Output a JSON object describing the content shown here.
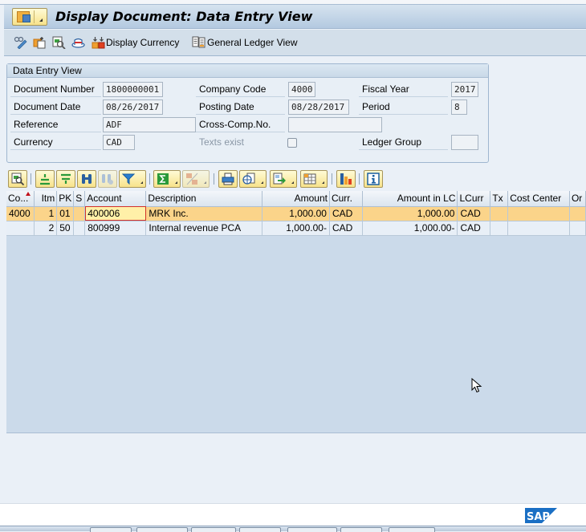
{
  "window": {
    "title": "Display Document: Data Entry View"
  },
  "application_toolbar": {
    "items": [
      {
        "name": "display-change-icon",
        "label": ""
      },
      {
        "name": "other-document-icon",
        "label": ""
      },
      {
        "name": "document-overview-icon",
        "label": ""
      },
      {
        "name": "hat-icon",
        "label": ""
      },
      {
        "name": "display-currency-button",
        "label": "Display Currency"
      },
      {
        "name": "general-ledger-view-button",
        "label": "General Ledger View"
      }
    ]
  },
  "header": {
    "group_title": "Data Entry View",
    "fields": {
      "document_number": {
        "label": "Document Number",
        "value": "1800000001"
      },
      "company_code": {
        "label": "Company Code",
        "value": "4000"
      },
      "fiscal_year": {
        "label": "Fiscal Year",
        "value": "2017"
      },
      "document_date": {
        "label": "Document Date",
        "value": "08/26/2017"
      },
      "posting_date": {
        "label": "Posting Date",
        "value": "08/28/2017"
      },
      "period": {
        "label": "Period",
        "value": "8"
      },
      "reference": {
        "label": "Reference",
        "value": "ADF"
      },
      "cross_comp_no": {
        "label": "Cross-Comp.No.",
        "value": ""
      },
      "currency": {
        "label": "Currency",
        "value": "CAD"
      },
      "texts_exist": {
        "label": "Texts exist",
        "checked": false
      },
      "ledger_group": {
        "label": "Ledger Group",
        "value": ""
      }
    }
  },
  "alv_toolbar": {
    "buttons": [
      "details-icon",
      "sort-ascending-icon",
      "sort-descending-icon",
      "find-icon",
      "find-next-icon",
      "filter-icon",
      "sum-icon",
      "subtotal-icon",
      "print-icon",
      "views-icon",
      "export-icon",
      "layout-icon",
      "graphic-icon",
      "info-icon"
    ]
  },
  "grid": {
    "columns": [
      "Co...",
      "Itm",
      "PK",
      "S",
      "Account",
      "Description",
      "Amount",
      "Curr.",
      "Amount in LC",
      "LCurr",
      "Tx",
      "Cost Center",
      "Or"
    ],
    "rows": [
      {
        "co": "4000",
        "itm": "1",
        "pk": "01",
        "s": "",
        "account": "400006",
        "description": "MRK Inc.",
        "amount": "1,000.00",
        "curr": "CAD",
        "amount_lc": "1,000.00",
        "lcurr": "CAD",
        "tx": "",
        "cost_center": "",
        "or": "",
        "selected": true
      },
      {
        "co": "",
        "itm": "2",
        "pk": "50",
        "s": "",
        "account": "800999",
        "description": "Internal revenue PCA",
        "amount": "1,000.00-",
        "curr": "CAD",
        "amount_lc": "1,000.00-",
        "lcurr": "CAD",
        "tx": "",
        "cost_center": "",
        "or": "",
        "selected": false
      }
    ]
  },
  "branding": {
    "logo_text": "SAP",
    "logo_color": "#1a6fc4"
  }
}
